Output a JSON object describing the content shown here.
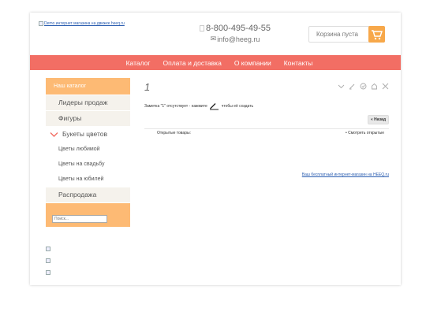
{
  "header": {
    "logo_alt": "Demo интернет магазина на движке heeq.ru",
    "phone": "8-800-495-49-55",
    "email": "info@heeg.ru",
    "cart_label": "Корзина пуста"
  },
  "nav": {
    "items": [
      "Каталог",
      "Оплата и доставка",
      "О компании",
      "Контакты"
    ]
  },
  "sidebar": {
    "heading": "Наш каталог",
    "items": [
      {
        "label": "Лидеры продаж"
      },
      {
        "label": "Фигуры"
      },
      {
        "label": "Букеты цветов"
      },
      {
        "label": "Цветы любимой"
      },
      {
        "label": "Цветы на свадьбу"
      },
      {
        "label": "Цветы на юбилей"
      },
      {
        "label": "Распродажа"
      }
    ],
    "search_placeholder": "Поиск..."
  },
  "main": {
    "note_title": "1",
    "notice_before": "Заметка \"1\" отсутствует - нажмите",
    "notice_after": "чтобы её создать",
    "back_label": "Назад",
    "open_goods_label": "Открытые товары:",
    "view_open_label": "Смотреть открытые",
    "free_shop_link": "Ваш бесплатный интернет-магазин на HEEQ.ru"
  },
  "colors": {
    "nav_bg": "#f26e64",
    "accent_orange": "#fdba74",
    "cart_icon_bg": "#f7a84a"
  }
}
